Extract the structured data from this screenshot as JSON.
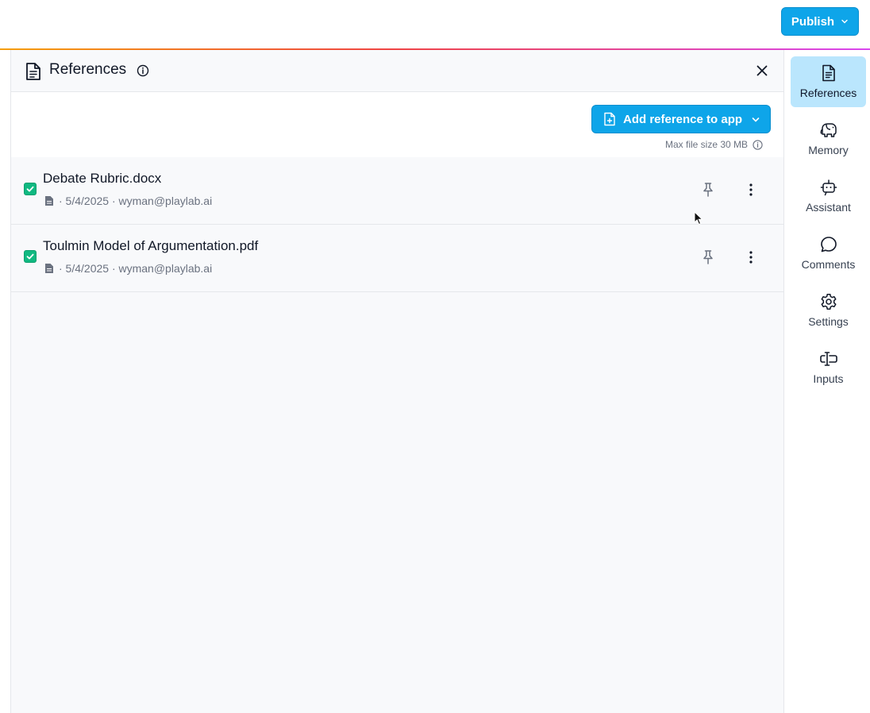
{
  "header": {
    "publish_label": "Publish"
  },
  "panel": {
    "title": "References",
    "add_button_label": "Add reference to app",
    "max_size_text": "Max file size 30 MB"
  },
  "references": [
    {
      "name": "Debate Rubric.docx",
      "meta": "· 5/4/2025 · wyman@playlab.ai",
      "checked": true
    },
    {
      "name": "Toulmin Model of Argumentation.pdf",
      "meta": "· 5/4/2025 · wyman@playlab.ai",
      "checked": true
    }
  ],
  "sidebar": {
    "items": [
      {
        "label": "References",
        "icon": "document-icon",
        "active": true
      },
      {
        "label": "Memory",
        "icon": "elephant-icon",
        "active": false
      },
      {
        "label": "Assistant",
        "icon": "robot-icon",
        "active": false
      },
      {
        "label": "Comments",
        "icon": "chat-bubble-icon",
        "active": false
      },
      {
        "label": "Settings",
        "icon": "gear-icon",
        "active": false
      },
      {
        "label": "Inputs",
        "icon": "text-cursor-input-icon",
        "active": false
      }
    ]
  },
  "colors": {
    "accent": "#0ea5e9",
    "checkbox": "#10b981",
    "active_nav": "#bae6fd"
  }
}
